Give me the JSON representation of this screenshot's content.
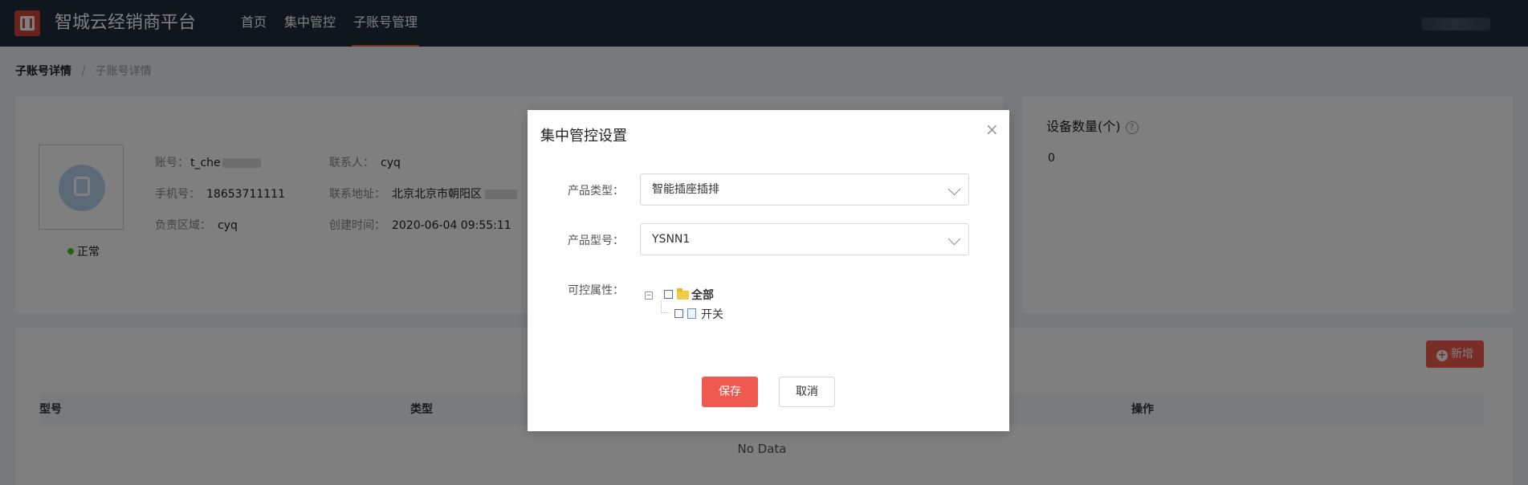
{
  "header": {
    "brand": "智城云经销商平台",
    "nav": [
      {
        "label": "首页",
        "active": false
      },
      {
        "label": "集中管控",
        "active": false
      },
      {
        "label": "子账号管理",
        "active": true
      }
    ]
  },
  "breadcrumb": {
    "parent": "子账号详情",
    "separator": "/",
    "current": "子账号详情"
  },
  "account": {
    "status": "正常",
    "fields": {
      "account_label": "账号：",
      "account_value": "t_che",
      "phone_label": "手机号：",
      "phone_value": "18653711111",
      "area_label": "负责区域：",
      "area_value": "cyq",
      "contact_label": "联系人：",
      "contact_value": "cyq",
      "address_label": "联系地址：",
      "address_value": "北京北京市朝阳区",
      "created_label": "创建时间：",
      "created_value": "2020-06-04 09:55:11"
    }
  },
  "device": {
    "title": "设备数量(个)",
    "help_icon": "?",
    "count": "0"
  },
  "table": {
    "add_button": "新增",
    "columns": [
      "型号",
      "类型",
      "操作"
    ],
    "empty_text": "No Data"
  },
  "modal": {
    "title": "集中管控设置",
    "close_icon": "×",
    "product_type_label": "产品类型：",
    "product_type_value": "智能插座插排",
    "product_model_label": "产品型号：",
    "product_model_value": "YSNN1",
    "controllable_label": "可控属性：",
    "tree": {
      "collapse_icon": "−",
      "root": "全部",
      "child": "开关"
    },
    "save": "保存",
    "cancel": "取消"
  },
  "colors": {
    "header_bg": "#1f2d3d",
    "accent": "#f05a4e",
    "status_ok": "#52c41a"
  }
}
